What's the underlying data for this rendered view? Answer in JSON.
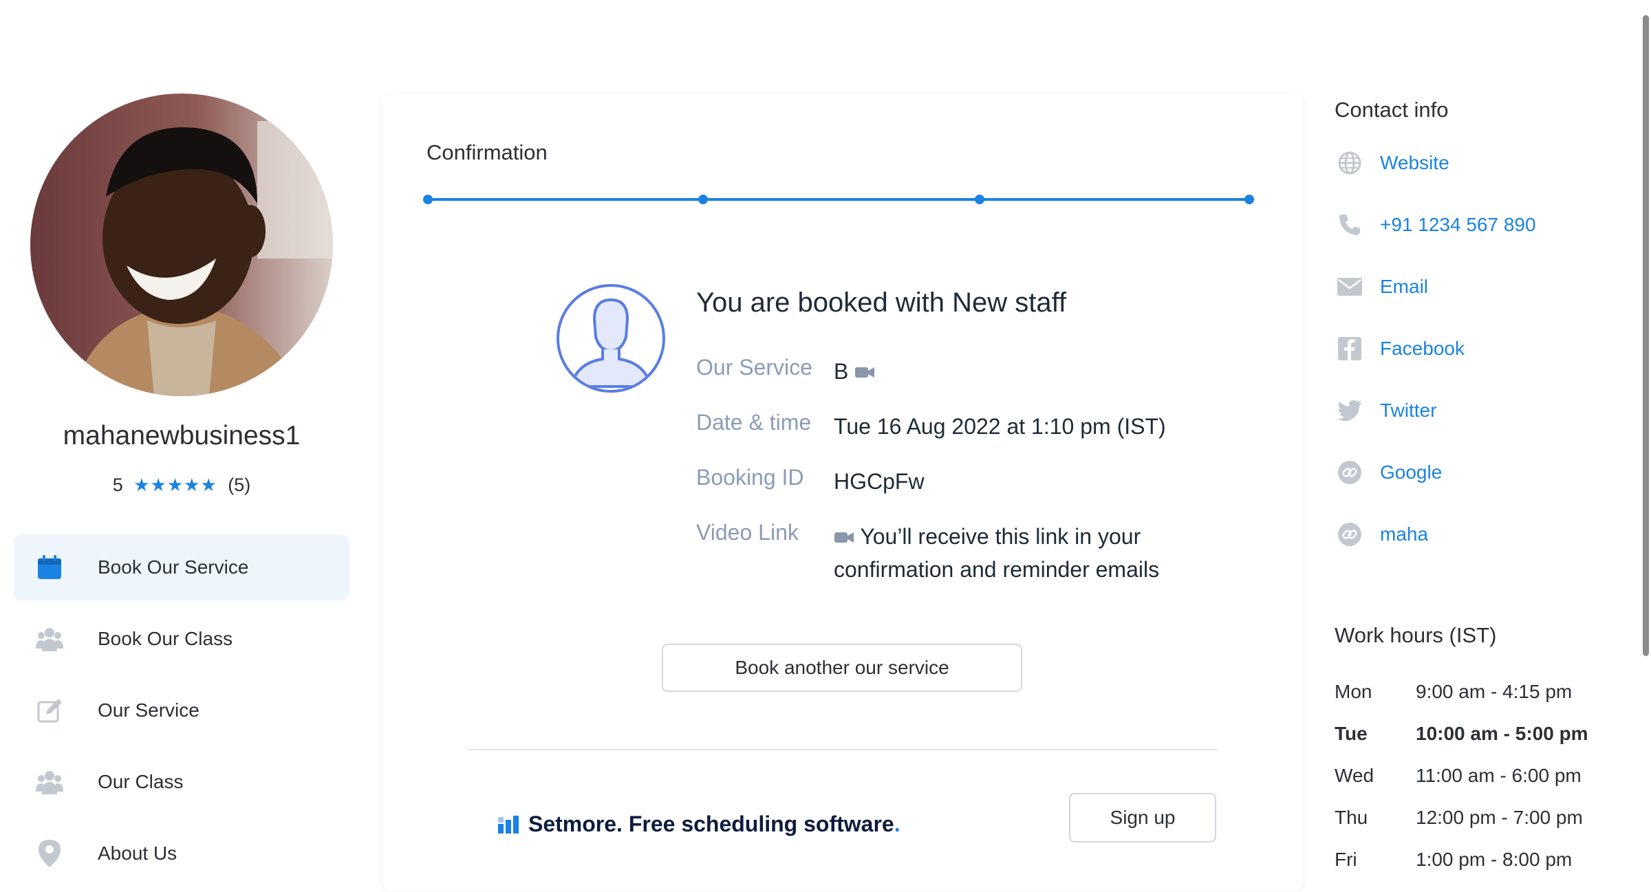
{
  "business": {
    "name": "mahanewbusiness1",
    "rating_value": "5",
    "rating_stars": "★★★★★",
    "rating_count": "(5)",
    "rating_fraction": 1.0
  },
  "nav": {
    "items": [
      {
        "label": "Book Our Service",
        "icon": "calendar-icon",
        "active": true
      },
      {
        "label": "Book Our Class",
        "icon": "group-icon",
        "active": false
      },
      {
        "label": "Our Service",
        "icon": "edit-icon",
        "active": false
      },
      {
        "label": "Our Class",
        "icon": "group-icon",
        "active": false
      },
      {
        "label": "About Us",
        "icon": "location-pin-icon",
        "active": false
      }
    ]
  },
  "confirmation": {
    "title": "Confirmation",
    "progress_steps": 4,
    "progress_complete_fraction": 1.0,
    "heading": "You are booked with New staff",
    "details": [
      {
        "key": "Our Service",
        "value": "B"
      },
      {
        "key": "Date & time",
        "value": "Tue 16 Aug 2022 at 1:10 pm (IST)"
      },
      {
        "key": "Booking ID",
        "value": "HGCpFw"
      },
      {
        "key": "Video Link",
        "value": "You’ll receive this link in your confirmation and reminder emails"
      }
    ],
    "book_another_label": "Book another our service"
  },
  "promo": {
    "brand_text": "Setmore. Free scheduling  software",
    "dot": ".",
    "signup_label": "Sign up"
  },
  "contact": {
    "title": "Contact info",
    "items": [
      {
        "label": "Website",
        "icon": "globe-icon"
      },
      {
        "label": "+91 1234 567 890",
        "icon": "phone-icon"
      },
      {
        "label": "Email",
        "icon": "envelope-icon"
      },
      {
        "label": "Facebook",
        "icon": "facebook-icon"
      },
      {
        "label": "Twitter",
        "icon": "twitter-icon"
      },
      {
        "label": "Google",
        "icon": "link-icon"
      },
      {
        "label": "maha",
        "icon": "link-icon"
      }
    ]
  },
  "hours": {
    "title": "Work hours (IST)",
    "rows": [
      {
        "day": "Mon",
        "time": "9:00 am - 4:15 pm",
        "today": false
      },
      {
        "day": "Tue",
        "time": "10:00 am - 5:00 pm",
        "today": true
      },
      {
        "day": "Wed",
        "time": "11:00 am - 6:00 pm",
        "today": false
      },
      {
        "day": "Thu",
        "time": "12:00 pm - 7:00 pm",
        "today": false
      },
      {
        "day": "Fri",
        "time": "1:00 pm - 8:00 pm",
        "today": false
      }
    ]
  },
  "colors": {
    "accent": "#1a82e2",
    "muted_label": "#8c9bb5",
    "active_nav_bg": "#eef5fd",
    "icon_gray": "#c3c8d0"
  }
}
